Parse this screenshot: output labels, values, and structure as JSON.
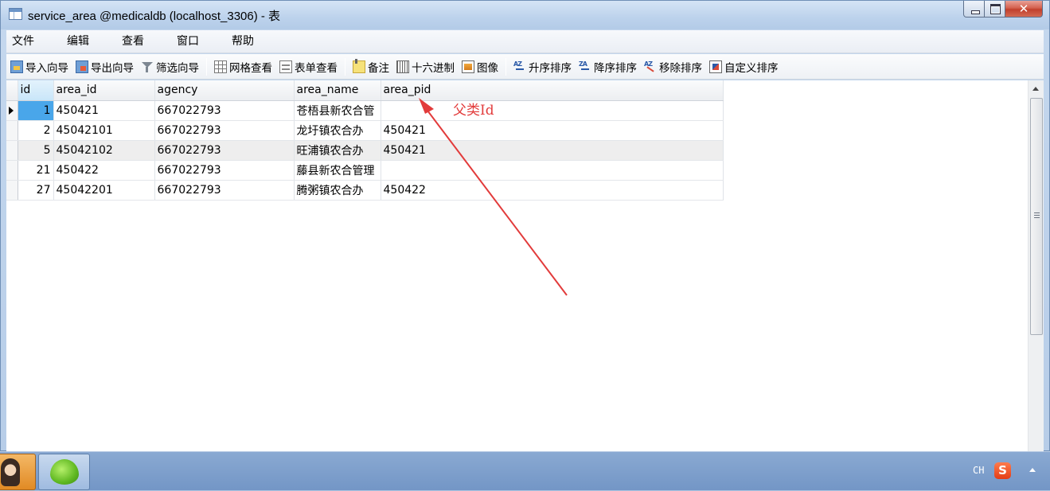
{
  "window": {
    "title": "service_area @medicaldb (localhost_3306) - 表",
    "close_label": "✕"
  },
  "menubar": {
    "items": [
      "文件",
      "编辑",
      "查看",
      "窗口",
      "帮助"
    ]
  },
  "toolbar": {
    "import_wizard": "导入向导",
    "export_wizard": "导出向导",
    "filter_wizard": "筛选向导",
    "grid_view": "网格查看",
    "form_view": "表单查看",
    "memo": "备注",
    "hex": "十六进制",
    "image": "图像",
    "sort_asc": "升序排序",
    "sort_desc": "降序排序",
    "remove_sort": "移除排序",
    "custom_sort": "自定义排序"
  },
  "table": {
    "columns": [
      "id",
      "area_id",
      "agency",
      "area_name",
      "area_pid"
    ],
    "rows": [
      {
        "id": "1",
        "area_id": "450421",
        "agency": "667022793",
        "area_name": "苍梧县新农合管",
        "area_pid": ""
      },
      {
        "id": "2",
        "area_id": "45042101",
        "agency": "667022793",
        "area_name": "龙圩镇农合办",
        "area_pid": "450421"
      },
      {
        "id": "5",
        "area_id": "45042102",
        "agency": "667022793",
        "area_name": "旺浦镇农合办",
        "area_pid": "450421"
      },
      {
        "id": "21",
        "area_id": "450422",
        "agency": "667022793",
        "area_name": "藤县新农合管理",
        "area_pid": ""
      },
      {
        "id": "27",
        "area_id": "45042201",
        "agency": "667022793",
        "area_name": "腾粥镇农合办",
        "area_pid": "450422"
      }
    ],
    "selected_row": 0
  },
  "annotation": {
    "text": "父类Id",
    "color": "#e23b3b"
  },
  "taskbar": {
    "tray": {
      "language": "CH",
      "ime_label": "S"
    }
  }
}
